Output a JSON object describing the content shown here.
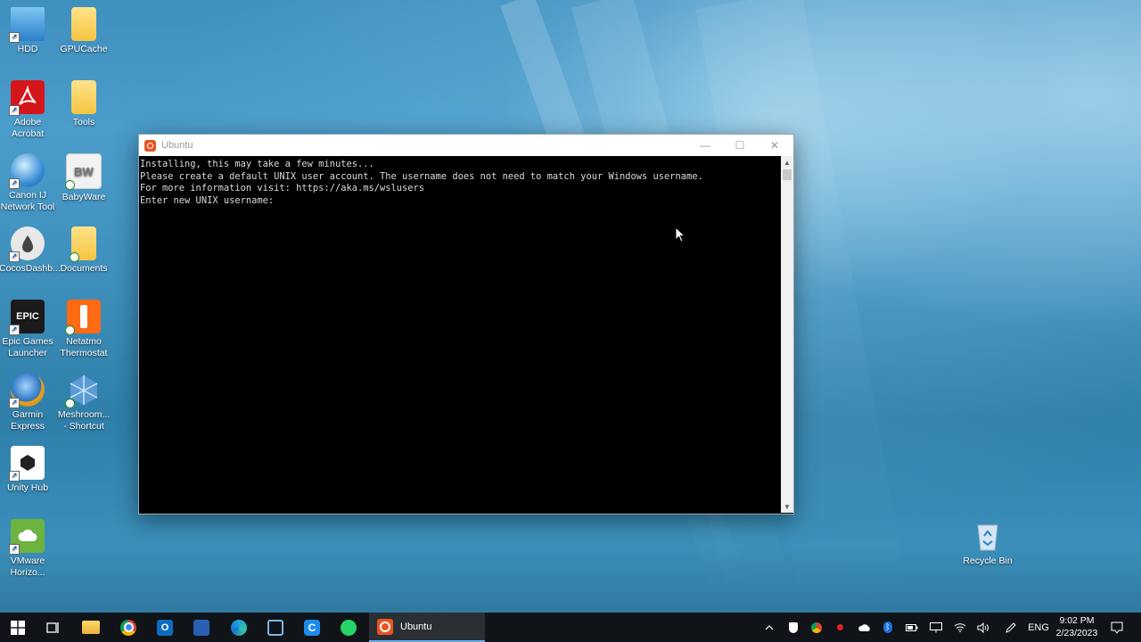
{
  "desktop_icons": [
    {
      "label": "HDD",
      "icon": "computer-icon"
    },
    {
      "label": "GPUCache",
      "icon": "folder-icon"
    },
    {
      "label": "Adobe Acrobat",
      "icon": "acrobat-icon"
    },
    {
      "label": "Tools",
      "icon": "folder-icon"
    },
    {
      "label": "Canon IJ Network Tool",
      "icon": "canon-globe-icon"
    },
    {
      "label": "BabyWare",
      "icon": "babyware-icon"
    },
    {
      "label": "CocosDashb...",
      "icon": "cocos-icon"
    },
    {
      "label": "Documents",
      "icon": "folder-icon"
    },
    {
      "label": "Epic Games Launcher",
      "icon": "epic-games-icon"
    },
    {
      "label": "Netatmo Thermostat",
      "icon": "netatmo-icon"
    },
    {
      "label": "Garmin Express",
      "icon": "garmin-icon"
    },
    {
      "label": "Meshroom... - Shortcut",
      "icon": "meshroom-icon"
    },
    {
      "label": "Unity Hub",
      "icon": "unity-icon"
    },
    {
      "label": "VMware Horizo...",
      "icon": "vmware-icon"
    },
    {
      "label": "Recycle Bin",
      "icon": "recycle-bin-icon"
    }
  ],
  "window": {
    "title": "Ubuntu",
    "minimize": "—",
    "maximize": "☐",
    "close": "✕",
    "terminal_lines": [
      "Installing, this may take a few minutes...",
      "Please create a default UNIX user account. The username does not need to match your Windows username.",
      "For more information visit: https://aka.ms/wslusers",
      "Enter new UNIX username: "
    ]
  },
  "taskbar": {
    "active_app_label": "Ubuntu",
    "language": "ENG",
    "time": "9:02 PM",
    "date": "2/23/2023"
  },
  "colors": {
    "ubuntu_orange": "#e95420",
    "taskbar_bg": "#101418"
  }
}
